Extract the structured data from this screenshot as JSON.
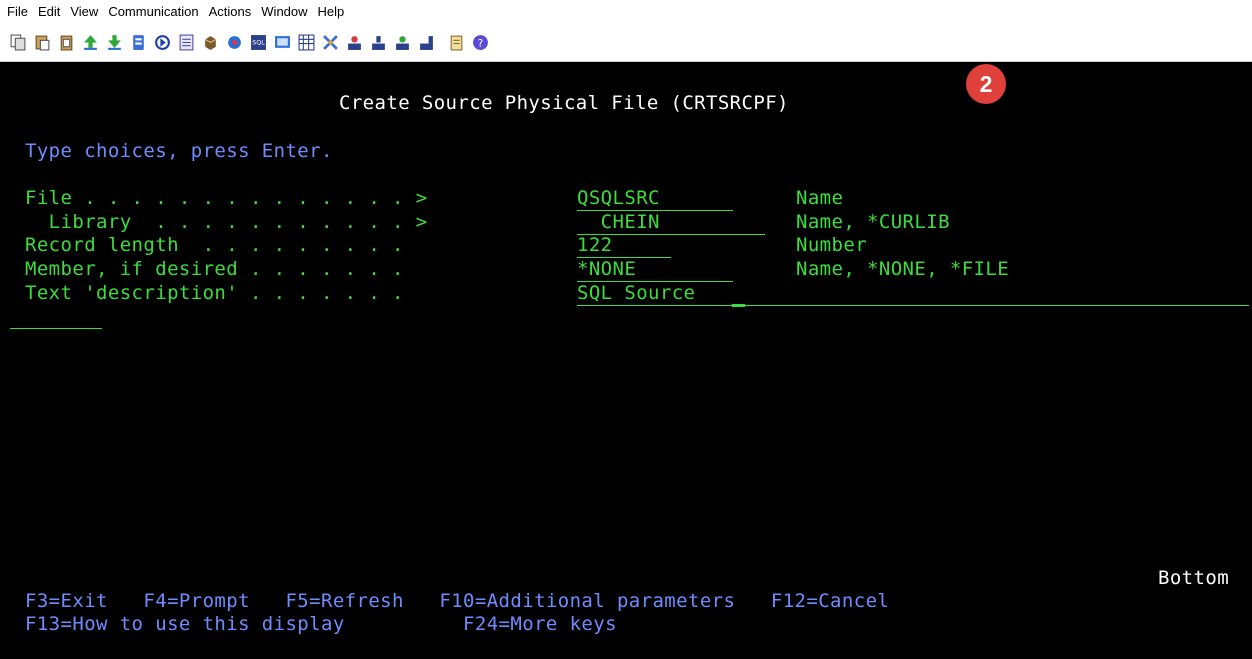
{
  "menu": [
    "File",
    "Edit",
    "View",
    "Communication",
    "Actions",
    "Window",
    "Help"
  ],
  "toolbar_icons": [
    "copy-icon",
    "paste-icon",
    "paste-special-icon",
    "send-file-icon",
    "receive-file-icon",
    "macro-icon",
    "play-icon",
    "notes-icon",
    "keyboard-icon",
    "display-setup-icon",
    "sql-icon",
    "screen-icon",
    "grid-icon",
    "tools-icon",
    "user-icon",
    "host-icon",
    "session-icon",
    "queue-icon",
    "clipboard-icon",
    "help-icon"
  ],
  "colors": {
    "title": "#ffffff",
    "prompt": "#6f8cff",
    "field": "#3cdc3c",
    "badge": "#e0403a"
  },
  "badge": "2",
  "screen": {
    "title": "Create Source Physical File (CRTSRCPF)",
    "instructions": "Type choices, press Enter.",
    "fields": [
      {
        "label": "File . . . . . . . . . . . . . . > ",
        "value": "QSQLSRC",
        "hint": "Name"
      },
      {
        "label": "  Library  . . . . . . . . . . . > ",
        "value": "  CHEIN",
        "hint": "Name, *CURLIB"
      },
      {
        "label": "Record length  . . . . . . . . .   ",
        "value": "122",
        "hint": "Number"
      },
      {
        "label": "Member, if desired . . . . . . .   ",
        "value": "*NONE",
        "hint": "Name, *NONE, *FILE"
      },
      {
        "label": "Text 'description' . . . . . . .   ",
        "value": "SQL Source",
        "hint": ""
      }
    ],
    "status": "Bottom",
    "fkeys_row1": "F3=Exit   F4=Prompt   F5=Refresh   F10=Additional parameters   F12=Cancel",
    "fkeys_row2": "F13=How to use this display          F24=More keys"
  }
}
